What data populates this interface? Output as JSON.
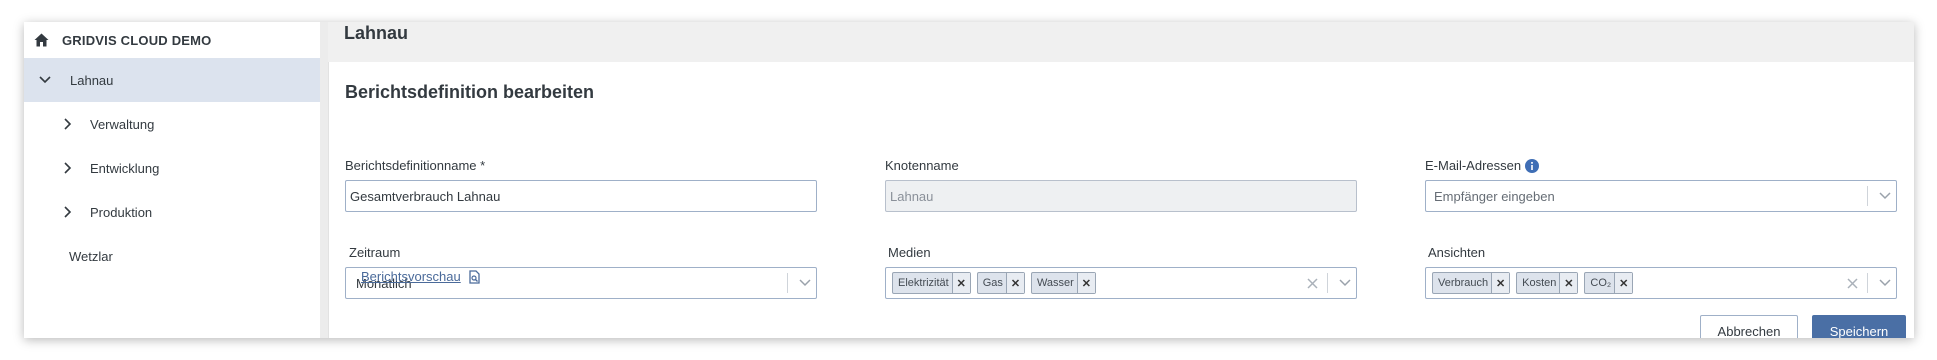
{
  "sidebar": {
    "root_label": "GRIDVIS CLOUD DEMO",
    "items": [
      {
        "label": "Lahnau"
      },
      {
        "label": "Verwaltung"
      },
      {
        "label": "Entwicklung"
      },
      {
        "label": "Produktion"
      },
      {
        "label": "Wetzlar"
      }
    ]
  },
  "header": {
    "title": "Lahnau"
  },
  "form": {
    "title": "Berichtsdefinition bearbeiten",
    "name_label": "Berichtsdefinitionname *",
    "name_value": "Gesamtverbrauch Lahnau",
    "node_label": "Knotenname",
    "node_placeholder": "Lahnau",
    "email_label": "E-Mail-Adressen",
    "email_placeholder": "Empfänger eingeben",
    "period_label": "Zeitraum",
    "period_value": "Monatlich",
    "media_label": "Medien",
    "media_tags": [
      "Elektrizität",
      "Gas",
      "Wasser"
    ],
    "views_label": "Ansichten",
    "views_tags": [
      "Verbrauch",
      "Kosten",
      "CO₂"
    ]
  },
  "actions": {
    "preview_label": "Berichtsvorschau",
    "cancel_label": "Abbrechen",
    "save_label": "Speichern"
  },
  "colors": {
    "accent": "#4a6fa5",
    "sidebar_active": "#dce3ee",
    "link": "#4a6a9a",
    "info_icon": "#3f6eb5"
  },
  "icons": [
    "home-icon",
    "chevron-down-icon",
    "chevron-right-icon",
    "info-icon",
    "clear-icon",
    "document-preview-icon"
  ]
}
